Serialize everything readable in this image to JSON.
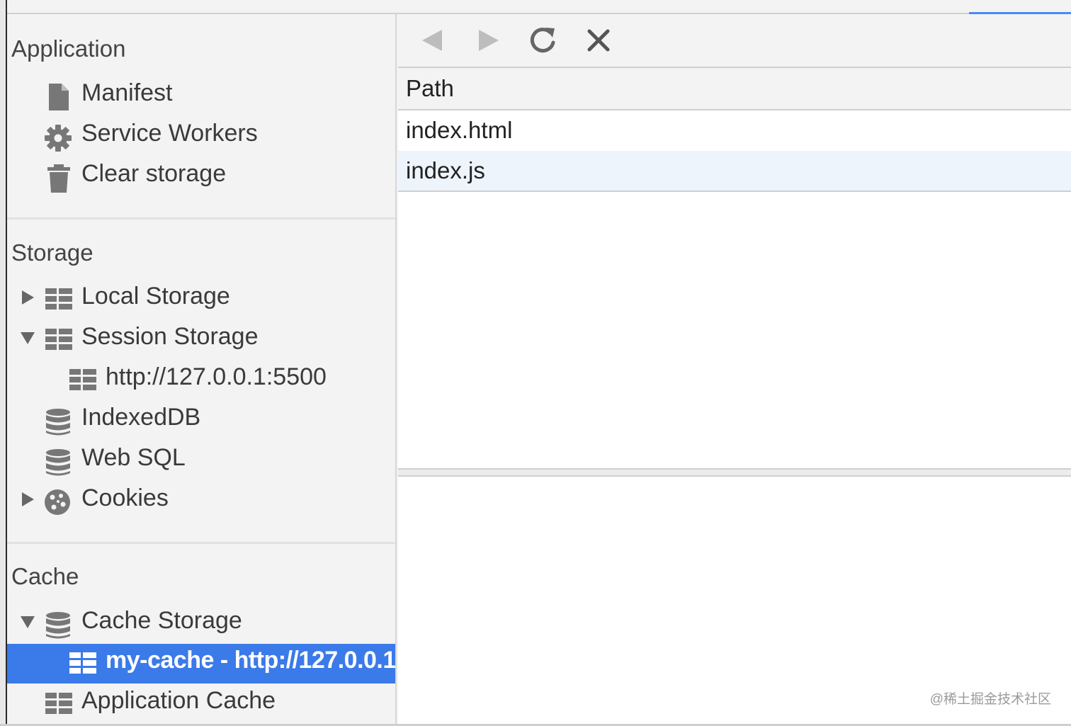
{
  "sidebar": {
    "application": {
      "title": "Application",
      "items": [
        {
          "label": "Manifest",
          "icon": "document-icon"
        },
        {
          "label": "Service Workers",
          "icon": "gear-icon"
        },
        {
          "label": "Clear storage",
          "icon": "trash-icon"
        }
      ]
    },
    "storage": {
      "title": "Storage",
      "items": [
        {
          "label": "Local Storage",
          "icon": "grid-icon",
          "expanded": false
        },
        {
          "label": "Session Storage",
          "icon": "grid-icon",
          "expanded": true
        },
        {
          "label": "http://127.0.0.1:5500",
          "icon": "grid-icon"
        },
        {
          "label": "IndexedDB",
          "icon": "database-icon"
        },
        {
          "label": "Web SQL",
          "icon": "database-icon"
        },
        {
          "label": "Cookies",
          "icon": "cookie-icon",
          "expanded": false
        }
      ]
    },
    "cache": {
      "title": "Cache",
      "items": [
        {
          "label": "Cache Storage",
          "icon": "database-icon",
          "expanded": true
        },
        {
          "label": "my-cache - http://127.0.0.1",
          "icon": "grid-icon",
          "selected": true
        },
        {
          "label": "Application Cache",
          "icon": "grid-icon"
        }
      ]
    }
  },
  "toolbar": {
    "back_icon": "back-arrow-icon",
    "forward_icon": "forward-arrow-icon",
    "refresh_icon": "refresh-icon",
    "delete_icon": "close-icon"
  },
  "table": {
    "column": "Path",
    "rows": [
      "index.html",
      "index.js"
    ]
  },
  "watermark": "@稀土掘金技术社区",
  "colors": {
    "selection": "#3b7ae9",
    "accent": "#4a8af4",
    "row_alt": "#eef4fc"
  }
}
